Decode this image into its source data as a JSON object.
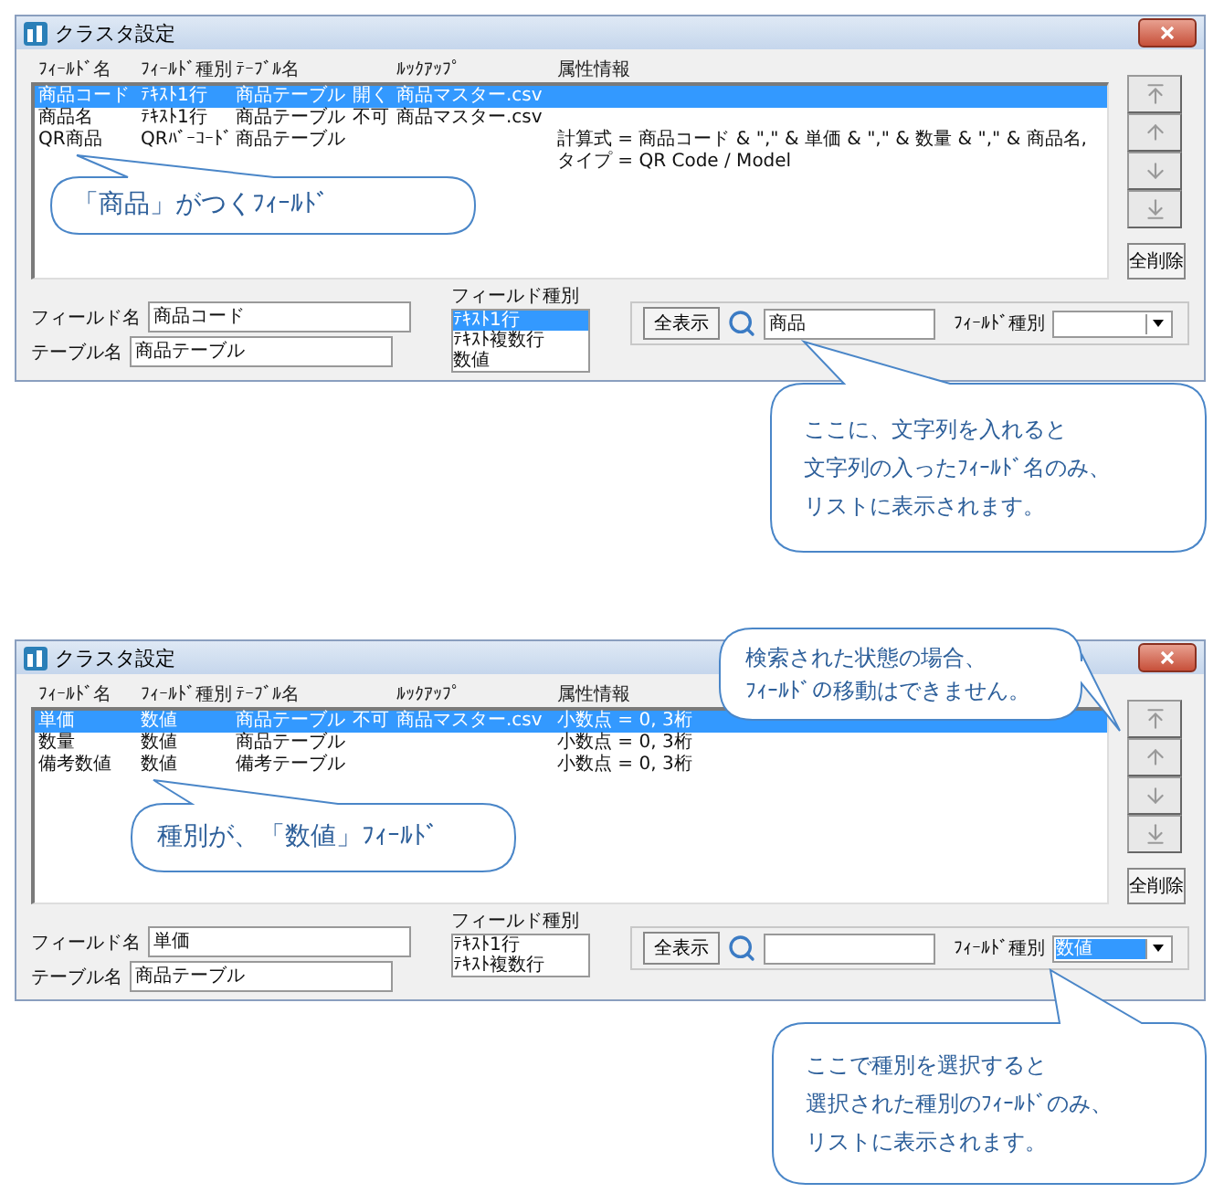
{
  "pages": [
    {
      "window": {
        "title": "クラスタ設定"
      },
      "list": {
        "columns": [
          "ﾌｨｰﾙﾄﾞ名",
          "ﾌｨｰﾙﾄﾞ種別",
          "ﾃｰﾌﾞﾙ名",
          "ﾙｯｸｱｯﾌﾟ",
          "属性情報"
        ],
        "rows": [
          {
            "name": "商品コード",
            "type": "ﾃｷｽﾄ1行",
            "table": "商品テーブル",
            "lookup_mode": "開く",
            "lookup": "商品マスター.csv",
            "selected": true
          },
          {
            "name": "商品名",
            "type": "ﾃｷｽﾄ1行",
            "table": "商品テーブル",
            "lookup_mode": "不可",
            "lookup": "商品マスター.csv",
            "selected": false
          },
          {
            "name": "QR商品",
            "type": "QRﾊﾞｰｺｰﾄﾞ",
            "table": "商品テーブル",
            "attribute": "計算式 = 商品コード & \",\" & 単価 & \",\" & 数量 & \",\" & 商品名, タイプ = QR Code / Model",
            "selected": false
          }
        ]
      },
      "clear_button": "全削除",
      "form": [
        {
          "label": "フィールド名",
          "value": "商品コード"
        },
        {
          "label": "テーブル名",
          "value": "商品テーブル"
        }
      ],
      "field_type": {
        "label": "フィールド種別",
        "items": [
          {
            "label": "ﾃｷｽﾄ1行",
            "selected": true
          },
          {
            "label": "ﾃｷｽﾄ複数行",
            "selected": false
          },
          {
            "label": "数値",
            "selected": false
          }
        ]
      },
      "search": {
        "show_all_button": "全表示",
        "value": "商品",
        "type_label": "ﾌｨｰﾙﾄﾞ種別",
        "type_highlighted": false
      },
      "callouts": [
        {
          "lines": [
            "「商品」がつくﾌｨｰﾙﾄﾞ"
          ]
        },
        {
          "lines": [
            "ここに、文字列を入れると",
            "文字列の入ったﾌｨｰﾙﾄﾞ名のみ、",
            "リストに表示されます。"
          ]
        }
      ]
    },
    {
      "window": {
        "title": "クラスタ設定"
      },
      "list": {
        "columns": [
          "ﾌｨｰﾙﾄﾞ名",
          "ﾌｨｰﾙﾄﾞ種別",
          "ﾃｰﾌﾞﾙ名",
          "ﾙｯｸｱｯﾌﾟ",
          "属性情報"
        ],
        "rows": [
          {
            "name": "単価",
            "type": "数値",
            "table": "商品テーブル",
            "lookup_mode": "不可",
            "lookup": "商品マスター.csv",
            "attribute": "小数点 = 0, 3桁",
            "selected": true
          },
          {
            "name": "数量",
            "type": "数値",
            "table": "商品テーブル",
            "attribute": "小数点 = 0, 3桁",
            "selected": false
          },
          {
            "name": "備考数値",
            "type": "数値",
            "table": "備考テーブル",
            "attribute": "小数点 = 0, 3桁",
            "selected": false
          }
        ]
      },
      "clear_button": "全削除",
      "form": [
        {
          "label": "フィールド名",
          "value": "単価"
        },
        {
          "label": "テーブル名",
          "value": "商品テーブル"
        }
      ],
      "field_type": {
        "label": "フィールド種別",
        "items": [
          {
            "label": "ﾃｷｽﾄ1行",
            "selected": false
          },
          {
            "label": "ﾃｷｽﾄ複数行",
            "selected": false
          }
        ]
      },
      "search": {
        "show_all_button": "全表示",
        "type_label": "ﾌｨｰﾙﾄﾞ種別",
        "type_value": "数値",
        "type_highlighted": true
      },
      "callouts": [
        {
          "lines": [
            "種別が、「数値」ﾌｨｰﾙﾄﾞ"
          ]
        },
        {
          "lines": [
            "検索された状態の場合、",
            "ﾌｨｰﾙﾄﾞの移動はできません。"
          ]
        },
        {
          "lines": [
            "ここで種別を選択すると",
            "選択された種別のﾌｨｰﾙﾄﾞのみ、",
            "リストに表示されます。"
          ]
        }
      ]
    }
  ]
}
